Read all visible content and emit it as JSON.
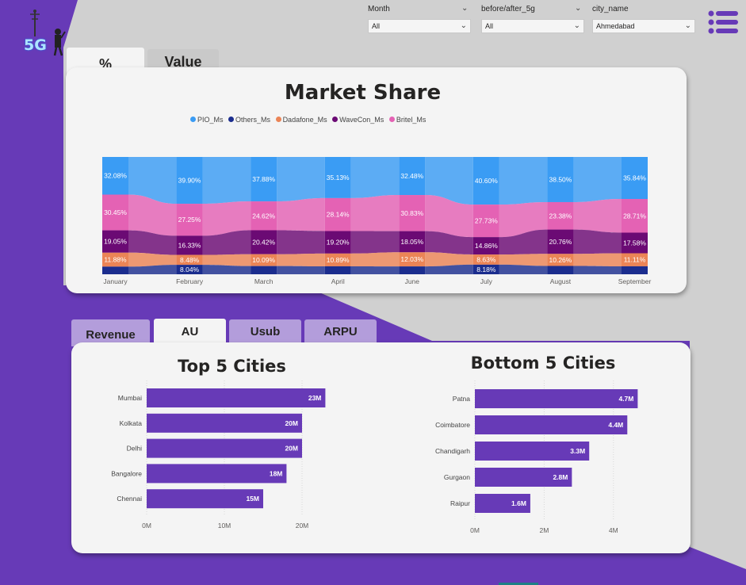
{
  "logo": {
    "text": "5G"
  },
  "filters": [
    {
      "label": "Month",
      "value": "All"
    },
    {
      "label": "before/after_5g",
      "value": "All"
    },
    {
      "label": "city_name",
      "value": "Ahmedabad"
    }
  ],
  "top_tabs": [
    {
      "label": "%",
      "active": true
    },
    {
      "label": "Value",
      "active": false
    }
  ],
  "bottom_tabs": [
    {
      "label": "Revenue",
      "active": false
    },
    {
      "label": "AU",
      "active": true
    },
    {
      "label": "Usub",
      "active": false
    },
    {
      "label": "ARPU",
      "active": false
    }
  ],
  "colors": {
    "purple_bg": "#673ab7",
    "card_bg": "#f4f4f4",
    "pio": "#3a9cf4",
    "others": "#1b2d8e",
    "dadafone": "#eb8456",
    "wavecon": "#6b0a74",
    "britel": "#e462b4",
    "bar": "#673ab7"
  },
  "chart_data": [
    {
      "type": "area",
      "subtype": "100% stacked ribbon",
      "title": "Market Share",
      "categories": [
        "January",
        "February",
        "March",
        "April",
        "June",
        "July",
        "August",
        "September"
      ],
      "series": [
        {
          "name": "PIO_Ms",
          "color": "#3a9cf4",
          "values": [
            32.08,
            39.9,
            37.88,
            35.13,
            32.48,
            40.6,
            38.5,
            35.84
          ],
          "labels": [
            "32.08%",
            "39.90%",
            "37.88%",
            "35.13%",
            "32.48%",
            "40.60%",
            "38.50%",
            "35.84%"
          ]
        },
        {
          "name": "Others_Ms",
          "color": "#1b2d8e",
          "values": [
            6.5,
            8.04,
            7.0,
            6.8,
            6.7,
            8.18,
            7.1,
            6.8
          ],
          "labels": [
            "",
            "8.04%",
            "",
            "",
            "",
            "8.18%",
            "",
            ""
          ]
        },
        {
          "name": "Dadafone_Ms",
          "color": "#eb8456",
          "values": [
            11.88,
            8.48,
            10.09,
            10.89,
            12.03,
            8.63,
            10.26,
            11.11
          ],
          "labels": [
            "11.88%",
            "8.48%",
            "10.09%",
            "10.89%",
            "12.03%",
            "8.63%",
            "10.26%",
            "11.11%"
          ]
        },
        {
          "name": "WaveCon_Ms",
          "color": "#6b0a74",
          "values": [
            19.05,
            16.33,
            20.42,
            19.2,
            18.05,
            14.86,
            20.76,
            17.58
          ],
          "labels": [
            "19.05%",
            "16.33%",
            "20.42%",
            "19.20%",
            "18.05%",
            "14.86%",
            "20.76%",
            "17.58%"
          ]
        },
        {
          "name": "Britel_Ms",
          "color": "#e462b4",
          "values": [
            30.45,
            27.25,
            24.62,
            28.14,
            30.83,
            27.73,
            23.38,
            28.71
          ],
          "labels": [
            "30.45%",
            "27.25%",
            "24.62%",
            "28.14%",
            "30.83%",
            "27.73%",
            "23.38%",
            "28.71%"
          ]
        }
      ]
    },
    {
      "type": "bar",
      "orientation": "horizontal",
      "title": "Top 5 Cities",
      "categories": [
        "Mumbai",
        "Kolkata",
        "Delhi",
        "Bangalore",
        "Chennai"
      ],
      "values": [
        23,
        20,
        20,
        18,
        15
      ],
      "value_labels": [
        "23M",
        "20M",
        "20M",
        "18M",
        "15M"
      ],
      "xticks": [
        "0M",
        "10M",
        "20M"
      ],
      "xlim": [
        0,
        20
      ],
      "grid": true
    },
    {
      "type": "bar",
      "orientation": "horizontal",
      "title": "Bottom 5 Cities",
      "categories": [
        "Patna",
        "Coimbatore",
        "Chandigarh",
        "Gurgaon",
        "Raipur"
      ],
      "values": [
        4.7,
        4.4,
        3.3,
        2.8,
        1.6
      ],
      "value_labels": [
        "4.7M",
        "4.4M",
        "3.3M",
        "2.8M",
        "1.6M"
      ],
      "xticks": [
        "0M",
        "2M",
        "4M"
      ],
      "xlim": [
        0,
        4
      ],
      "grid": true
    }
  ]
}
